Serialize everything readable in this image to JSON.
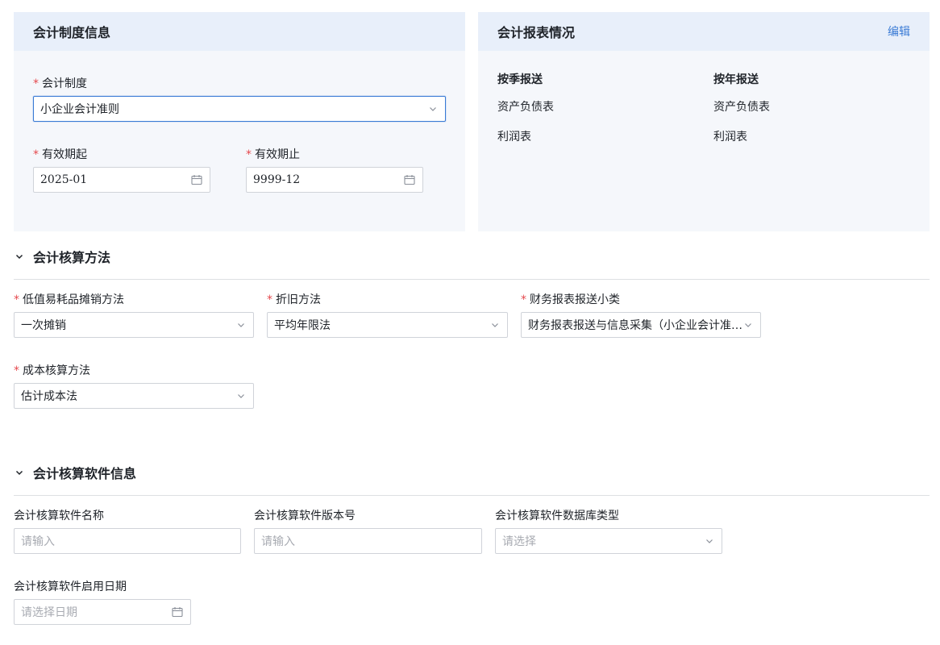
{
  "system_card": {
    "title": "会计制度信息",
    "required_mark": "*",
    "accounting_system_label": "会计制度",
    "accounting_system_value": "小企业会计准则",
    "valid_from_label": "有效期起",
    "valid_from_value": "2025-01",
    "valid_to_label": "有效期止",
    "valid_to_value": "9999-12"
  },
  "report_card": {
    "title": "会计报表情况",
    "edit_label": "编辑",
    "quarterly_head": "按季报送",
    "yearly_head": "按年报送",
    "quarterly_items": [
      "资产负债表",
      "利润表"
    ],
    "yearly_items": [
      "资产负债表",
      "利润表"
    ]
  },
  "method_section": {
    "title": "会计核算方法",
    "amortization_label": "低值易耗品摊销方法",
    "amortization_value": "一次摊销",
    "depreciation_label": "折旧方法",
    "depreciation_value": "平均年限法",
    "report_subtype_label": "财务报表报送小类",
    "report_subtype_value": "财务报表报送与信息采集（小企业会计准则）",
    "cost_label": "成本核算方法",
    "cost_value": "估计成本法"
  },
  "software_section": {
    "title": "会计核算软件信息",
    "name_label": "会计核算软件名称",
    "name_placeholder": "请输入",
    "version_label": "会计核算软件版本号",
    "version_placeholder": "请输入",
    "db_label": "会计核算软件数据库类型",
    "db_placeholder": "请选择",
    "start_date_label": "会计核算软件启用日期",
    "start_date_placeholder": "请选择日期"
  },
  "colors": {
    "accent": "#3a7bd5",
    "required": "#e5484d",
    "card_bg": "#f5f7fb",
    "card_header_bg": "#e8effa"
  },
  "icons": {
    "dropdown": "chevron-down-icon",
    "date": "calendar-icon",
    "section_toggle": "collapse-chevron-icon"
  }
}
